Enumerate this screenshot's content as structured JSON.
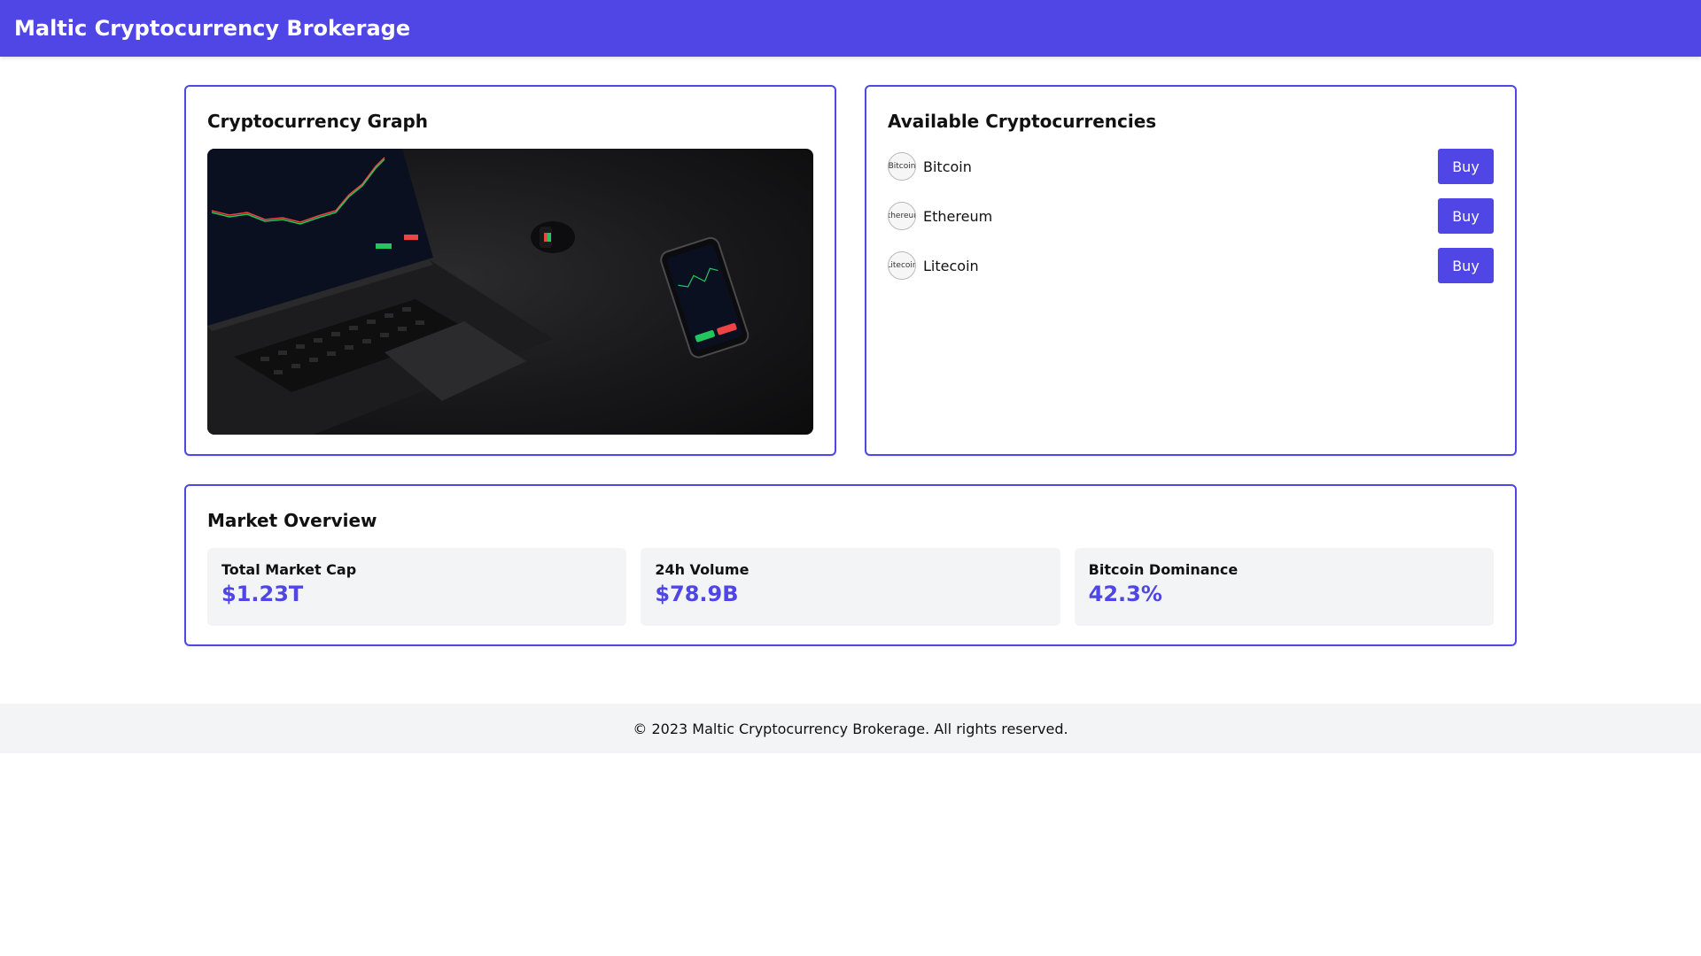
{
  "header": {
    "title": "Maltic Cryptocurrency Brokerage"
  },
  "graph": {
    "title": "Cryptocurrency Graph"
  },
  "crypto": {
    "title": "Available Cryptocurrencies",
    "items": [
      {
        "name": "Bitcoin",
        "alt": "Bitcoin",
        "buy_label": "Buy"
      },
      {
        "name": "Ethereum",
        "alt": "Ethereum",
        "buy_label": "Buy"
      },
      {
        "name": "Litecoin",
        "alt": "Litecoin",
        "buy_label": "Buy"
      }
    ]
  },
  "market": {
    "title": "Market Overview",
    "stats": [
      {
        "label": "Total Market Cap",
        "value": "$1.23T"
      },
      {
        "label": "24h Volume",
        "value": "$78.9B"
      },
      {
        "label": "Bitcoin Dominance",
        "value": "42.3%"
      }
    ]
  },
  "footer": {
    "text": "© 2023 Maltic Cryptocurrency Brokerage. All rights reserved."
  },
  "colors": {
    "accent": "#4f46e5",
    "panel": "#f3f4f6",
    "buy_green": "#22c55e",
    "sell_red": "#ef4444"
  }
}
